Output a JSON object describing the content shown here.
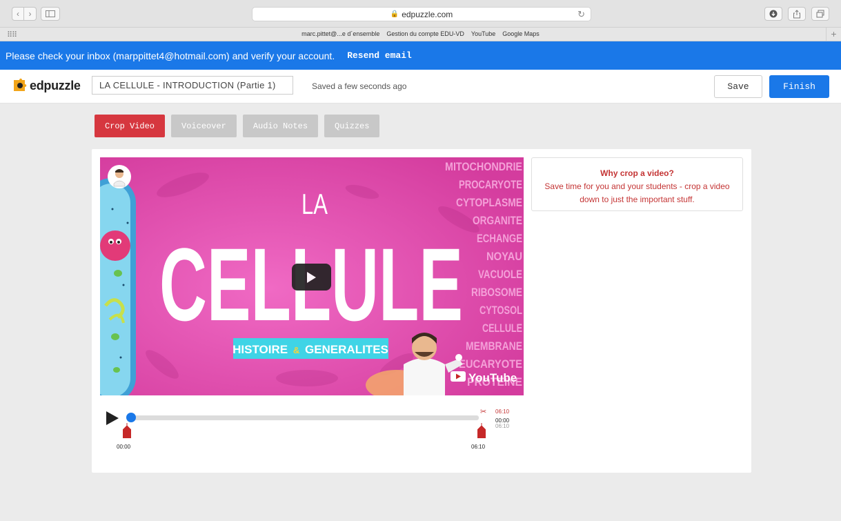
{
  "browser": {
    "url": "edpuzzle.com",
    "bookmarks": [
      "marc.pittet@...e d´ensemble",
      "Gestion du compte EDU-VD",
      "YouTube",
      "Google Maps"
    ]
  },
  "banner": {
    "message": "Please check your inbox (marppittet4@hotmail.com) and verify your account.",
    "resend_label": "Resend email"
  },
  "header": {
    "logo_text": "edpuzzle",
    "title_value": "LA CELLULE - INTRODUCTION (Partie 1)",
    "saved_status": "Saved a few seconds ago",
    "save_label": "Save",
    "finish_label": "Finish"
  },
  "tabs": [
    {
      "label": "Crop Video",
      "active": true
    },
    {
      "label": "Voiceover",
      "active": false
    },
    {
      "label": "Audio Notes",
      "active": false
    },
    {
      "label": "Quizzes",
      "active": false
    }
  ],
  "video": {
    "title_small": "LA",
    "title_big": "CELLULE",
    "subtitle_part1": "HISTOIRE",
    "subtitle_amp": "&",
    "subtitle_part2": "GENERALITES",
    "keywords": [
      "MITOCHONDRIE",
      "PROCARYOTE",
      "CYTOPLASME",
      "ORGANITE",
      "ECHANGE",
      "NOYAU",
      "VACUOLE",
      "RIBOSOME",
      "CYTOSOL",
      "CELLULE",
      "MEMBRANE",
      "EUCARYOTE",
      "PROTEINE"
    ],
    "youtube_label": "YouTube"
  },
  "info": {
    "title": "Why crop a video?",
    "body_line1": "Save time for you and your students - crop a video",
    "body_line2": "down to just the important stuff."
  },
  "timeline": {
    "start_time": "00:00",
    "end_time": "06:10",
    "crop_end_time": "06:10",
    "current_time": "00:00",
    "total_time": "06:10",
    "progress": 0
  },
  "colors": {
    "brand_blue": "#1a78e8",
    "active_tab": "#d6373f",
    "video_pink": "#e24dae",
    "info_red": "#c43434"
  }
}
